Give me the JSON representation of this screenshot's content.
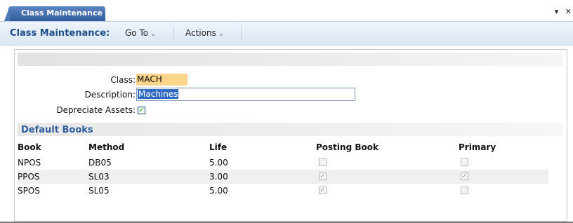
{
  "tab": {
    "label": "Class Maintenance"
  },
  "window_controls": {
    "menu": "▾",
    "close": "✕"
  },
  "toolbar": {
    "title": "Class Maintenance:",
    "goto_label": "Go To",
    "actions_label": "Actions",
    "caret": "⌄"
  },
  "form": {
    "class_label": "Class:",
    "class_value": "MACH",
    "description_label": "Description:",
    "description_value": "Machines",
    "depreciate_label": "Depreciate Assets:",
    "depreciate_checked": true
  },
  "default_books": {
    "title": "Default Books",
    "columns": [
      "Book",
      "Method",
      "Life",
      "Posting Book",
      "Primary"
    ],
    "rows": [
      {
        "book": "NPOS",
        "method": "DB05",
        "life": "5.00",
        "posting_book": false,
        "primary": false
      },
      {
        "book": "PPOS",
        "method": "SL03",
        "life": "3.00",
        "posting_book": true,
        "primary": true
      },
      {
        "book": "SPOS",
        "method": "SL05",
        "life": "5.00",
        "posting_book": true,
        "primary": false
      }
    ]
  },
  "colors": {
    "tab": "#2f5d9c",
    "toolbar_title": "#1c4e8a",
    "class_highlight": "#ffd58c",
    "selection": "#316ac5",
    "section_title": "#2f5d9c",
    "alt_row": "#efefef"
  }
}
